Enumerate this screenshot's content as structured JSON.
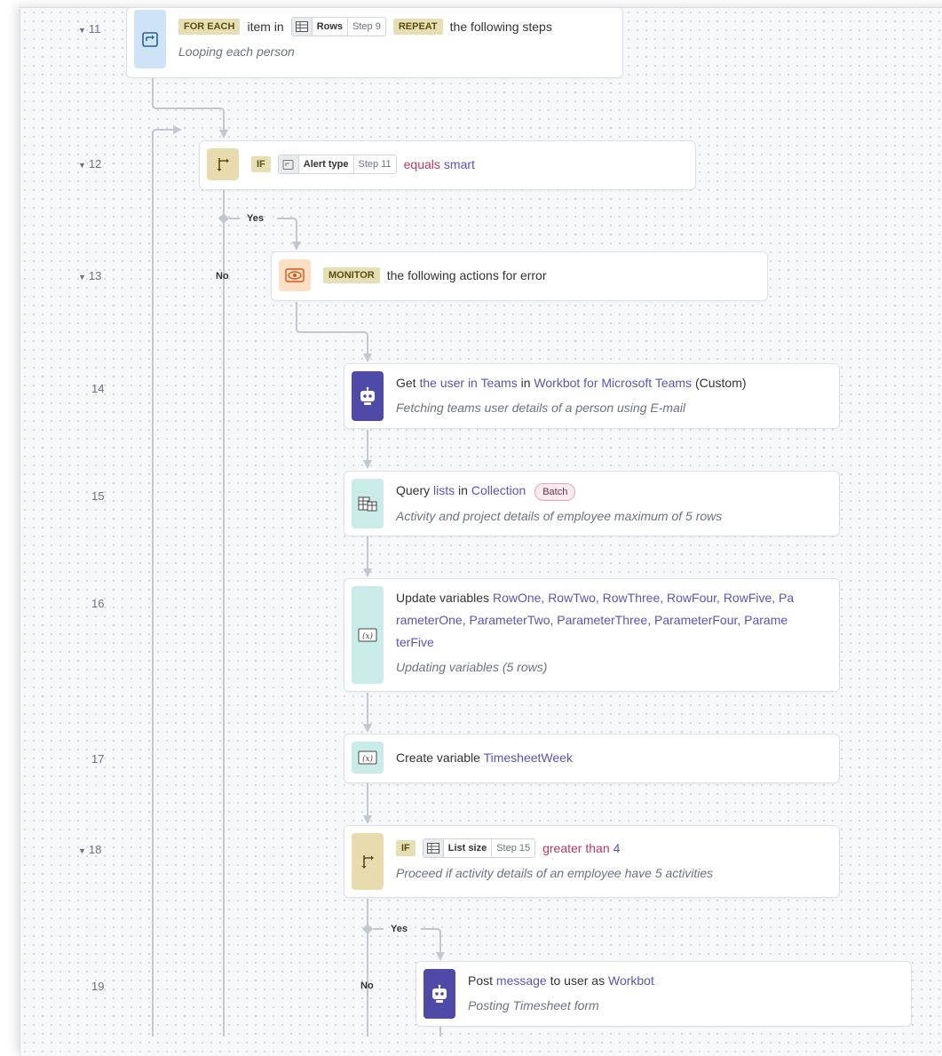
{
  "steps": {
    "s11": {
      "num": "11",
      "kw1": "FOR EACH",
      "t1": "item in",
      "pill_name": "Rows",
      "pill_step": "Step 9",
      "kw2": "REPEAT",
      "t2": "the following steps",
      "desc": "Looping each person"
    },
    "s12": {
      "num": "12",
      "kw": "IF",
      "pill_name": "Alert type",
      "pill_step": "Step 11",
      "op": "equals",
      "val": "smart"
    },
    "s13": {
      "num": "13",
      "kw": "MONITOR",
      "text": "the following actions for error"
    },
    "s14": {
      "num": "14",
      "t1": "Get",
      "obj": "the user in Teams",
      "t2": "in",
      "app": "Workbot for Microsoft Teams",
      "t3": "(Custom)",
      "desc": "Fetching teams user details of a person using E-mail"
    },
    "s15": {
      "num": "15",
      "t1": "Query",
      "obj": "lists",
      "t2": "in",
      "app": "Collection",
      "badge": "Batch",
      "desc": "Activity and project details of employee maximum of 5 rows"
    },
    "s16": {
      "num": "16",
      "t1": "Update variables",
      "line1": "RowOne, RowTwo, RowThree, RowFour, RowFive, Pa",
      "line2": "rameterOne, ParameterTwo, ParameterThree, ParameterFour, Parame",
      "line3": "terFive",
      "desc": "Updating variables (5 rows)"
    },
    "s17": {
      "num": "17",
      "t1": "Create variable",
      "var": "TimesheetWeek"
    },
    "s18": {
      "num": "18",
      "kw": "IF",
      "pill_name": "List size",
      "pill_step": "Step 15",
      "op": "greater than",
      "val": "4",
      "desc": "Proceed if activity details of an employee have 5 activities"
    },
    "s19": {
      "num": "19",
      "t1": "Post",
      "obj": "message",
      "t2": "to user as",
      "app": "Workbot",
      "desc": "Posting Timesheet form"
    }
  },
  "branches": {
    "yes": "Yes",
    "no": "No"
  },
  "colors": {
    "loop": "#cfe3f7",
    "if": "#e8dcae",
    "monitor": "#fde0c4",
    "bot": "#4f4aa8",
    "collection": "#c9ece8",
    "variable": "#c9ece8",
    "keyword": "#e6dfb3",
    "link": "#5a55b5",
    "operator": "#b73a5e"
  },
  "icons": {
    "s11": "loop-icon",
    "s12": "branch-icon",
    "s13": "eye-icon",
    "s14": "robot-icon",
    "s15": "table-icon",
    "s16": "variable-icon",
    "s17": "variable-icon",
    "s18": "branch-icon",
    "s19": "robot-icon"
  }
}
